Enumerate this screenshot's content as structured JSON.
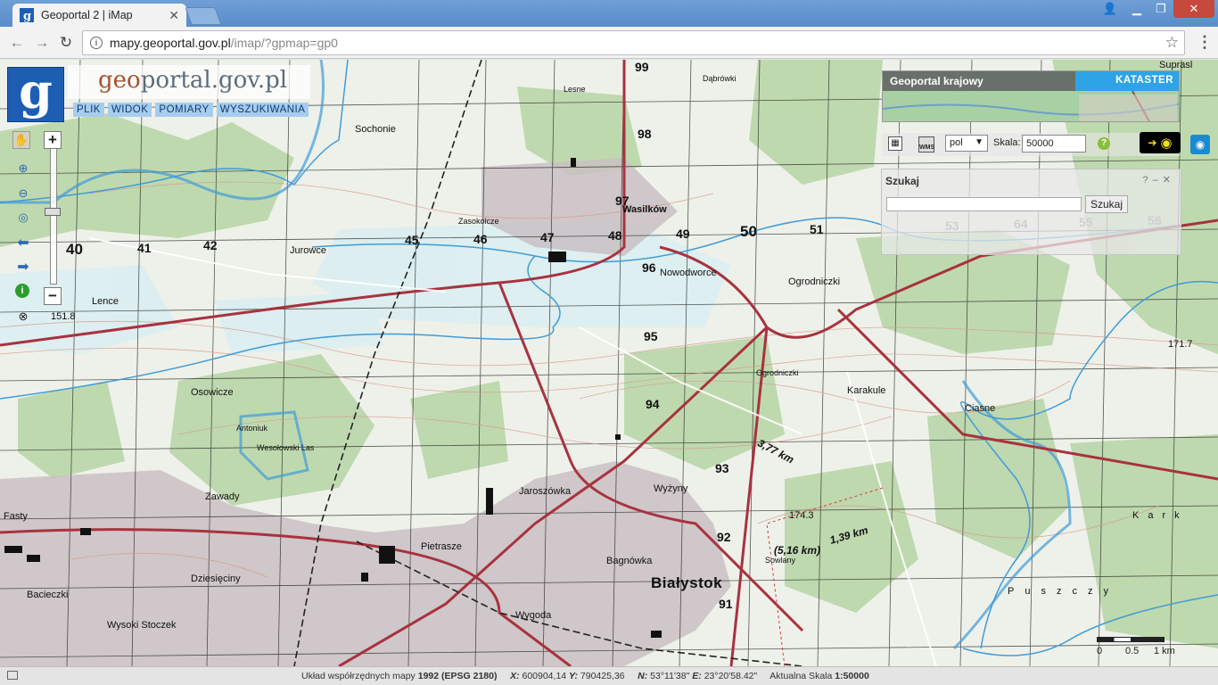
{
  "browser": {
    "tab_title": "Geoportal 2 | iMap",
    "url_host": "mapy.geoportal.gov.pl",
    "url_path": "/imap/?gpmap=gp0"
  },
  "header": {
    "site_title_a": "geo",
    "site_title_b": "portal",
    "site_title_c": ".gov.pl",
    "menu": [
      "PLIK",
      "WIDOK",
      "POMIARY",
      "WYSZUKIWANIA"
    ]
  },
  "overview": {
    "left_label": "Geoportal krajowy",
    "right_label": "KATASTER"
  },
  "toolbar": {
    "language": "pol",
    "scale_label": "Skala:",
    "scale_value": "50000",
    "help": "?"
  },
  "search": {
    "title": "Szukaj",
    "button": "Szukaj",
    "input_value": ""
  },
  "map": {
    "grid_numbers": [
      "99",
      "98",
      "97",
      "96",
      "95",
      "94",
      "93",
      "92",
      "91",
      "40",
      "41",
      "42",
      "45",
      "46",
      "47",
      "48",
      "49",
      "50",
      "51",
      "53",
      "64",
      "55",
      "56"
    ],
    "places": [
      "Dąbrówki",
      "Sochonie",
      "Jurowce",
      "Wasilków",
      "Nowodworce",
      "Ogrodniczki",
      "Lence",
      "Osowicze",
      "Antoniuk",
      "Zawady",
      "Fasty",
      "Pietrasze",
      "Jaroszówka",
      "Wyżyny",
      "Bagnówka",
      "Białystok",
      "Wygoda",
      "Dziesięciny",
      "Bacieczki",
      "Wysoki Stoczek",
      "Karakule",
      "Ciasne",
      "Sowlany",
      "Zasokolcze",
      "Lesne",
      "Suprasl",
      "Puszczy",
      "Kark",
      "Ogrodniczki",
      "Wesołowski Las"
    ],
    "heights": [
      "151.8",
      "174.3",
      "171.7"
    ],
    "distances": [
      "3,77 km",
      "(5,16 km)",
      "1,39 km"
    ]
  },
  "scalebar": {
    "zero": "0",
    "mid": "0.5",
    "end": "1 km"
  },
  "status": {
    "crs_label": "Układ współrzędnych mapy",
    "crs_value": "1992 (EPSG 2180)",
    "x_label": "X:",
    "x_value": "600904,14",
    "y_label": "Y:",
    "y_value": "790425,36",
    "n_label": "N:",
    "n_value": "53°11'38\"",
    "e_label": "E:",
    "e_value": "23°20'58.42\"",
    "scale_label": "Aktualna Skala",
    "scale_value": "1:50000"
  }
}
